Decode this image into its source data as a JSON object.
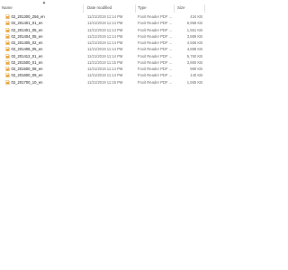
{
  "header": {
    "name": "Name",
    "date_modified": "Date modified",
    "type": "Type",
    "size": "Size"
  },
  "colors": {
    "pdf_icon": "#e8a33a",
    "header_text": "#4d4d4d",
    "secondary_text": "#6b6b6b"
  },
  "files": [
    {
      "name": "02_201300_256_en",
      "date": "11/21/2019 11:14 PM",
      "type": "Foxit Reader PDF ...",
      "size": "434 KB",
      "icon": "pdf-file-icon"
    },
    {
      "name": "02_201401_01_en",
      "date": "11/21/2019 11:14 PM",
      "type": "Foxit Reader PDF ...",
      "size": "6,958 KB",
      "icon": "pdf-file-icon"
    },
    {
      "name": "02_201401_05_en",
      "date": "11/21/2019 11:14 PM",
      "type": "Foxit Reader PDF ...",
      "size": "1,561 KB",
      "icon": "pdf-file-icon"
    },
    {
      "name": "02_201404_05_en",
      "date": "11/21/2019 11:14 PM",
      "type": "Foxit Reader PDF ...",
      "size": "3,889 KB",
      "icon": "pdf-file-icon"
    },
    {
      "name": "02_201405_02_en",
      "date": "11/21/2019 11:14 PM",
      "type": "Foxit Reader PDF ...",
      "size": "4,556 KB",
      "icon": "pdf-file-icon"
    },
    {
      "name": "02_201408_05_en",
      "date": "11/21/2019 11:14 PM",
      "type": "Foxit Reader PDF ...",
      "size": "4,888 KB",
      "icon": "pdf-file-icon"
    },
    {
      "name": "02_201412_01_en",
      "date": "11/21/2019 11:14 PM",
      "type": "Foxit Reader PDF ...",
      "size": "5,760 KB",
      "icon": "pdf-file-icon"
    },
    {
      "name": "02_201500_01_en",
      "date": "11/21/2019 11:15 PM",
      "type": "Foxit Reader PDF ...",
      "size": "3,860 KB",
      "icon": "pdf-file-icon"
    },
    {
      "name": "02_201500_08_en",
      "date": "11/21/2019 11:14 PM",
      "type": "Foxit Reader PDF ...",
      "size": "980 KB",
      "icon": "pdf-file-icon"
    },
    {
      "name": "02_201600_09_en",
      "date": "11/21/2019 11:14 PM",
      "type": "Foxit Reader PDF ...",
      "size": "140 KB",
      "icon": "pdf-file-icon"
    },
    {
      "name": "02_201700_10_en",
      "date": "11/21/2019 11:15 PM",
      "type": "Foxit Reader PDF ...",
      "size": "1,555 KB",
      "icon": "pdf-file-icon"
    }
  ]
}
